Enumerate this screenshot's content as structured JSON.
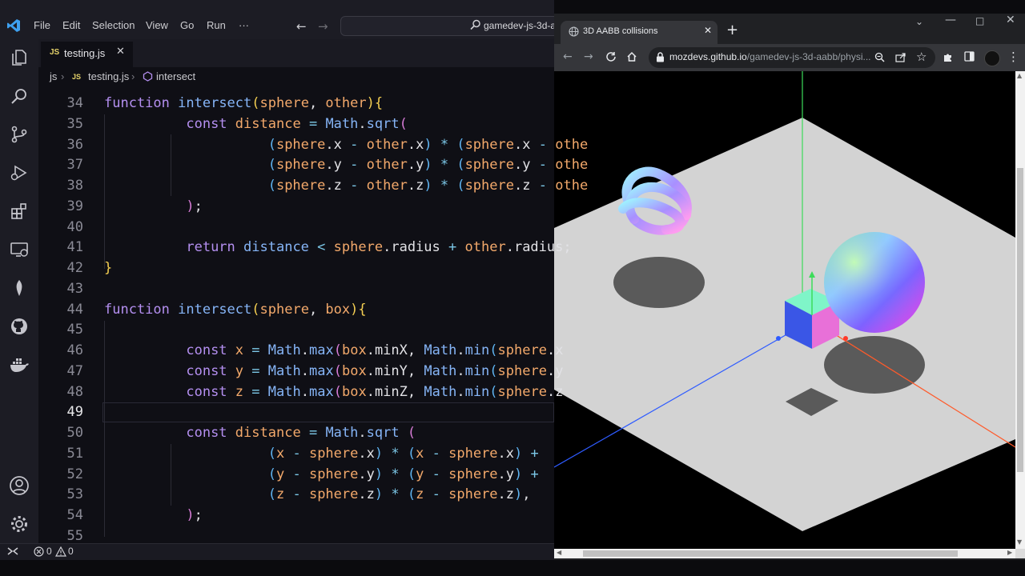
{
  "vscode": {
    "menu": [
      "File",
      "Edit",
      "Selection",
      "View",
      "Go",
      "Run",
      "···"
    ],
    "command_center_text": "gamedev-js-3d-a",
    "tab": {
      "badge": "JS",
      "name": "testing.js"
    },
    "breadcrumb": [
      "js",
      "JS",
      "testing.js",
      "intersect"
    ],
    "line_numbers": [
      "34",
      "35",
      "36",
      "37",
      "38",
      "39",
      "40",
      "41",
      "42",
      "43",
      "44",
      "45",
      "46",
      "47",
      "48",
      "49",
      "50",
      "51",
      "52",
      "53",
      "54",
      "55"
    ],
    "current_line": "49",
    "status": {
      "errors": "0",
      "warnings": "0"
    },
    "activity_icons": [
      "explorer-icon",
      "search-icon",
      "source-control-icon",
      "run-debug-icon",
      "extensions-icon",
      "remote-explorer-icon",
      "mongodb-icon",
      "github-icon",
      "docker-icon",
      "accounts-icon",
      "settings-gear-icon"
    ]
  },
  "browser": {
    "tab_title": "3D AABB collisions",
    "url_host": "mozdevs.github.io",
    "url_path": "/gamedev-js-3d-aabb/physi..."
  },
  "colors": {
    "editor_bg": "#0f0f15",
    "keyword": "#b48ff0",
    "function": "#86b5f7",
    "param": "#f3a96b",
    "operator": "#7cc8e8",
    "browser_bg": "#202124",
    "ground_plane": "#d3d3d3"
  }
}
